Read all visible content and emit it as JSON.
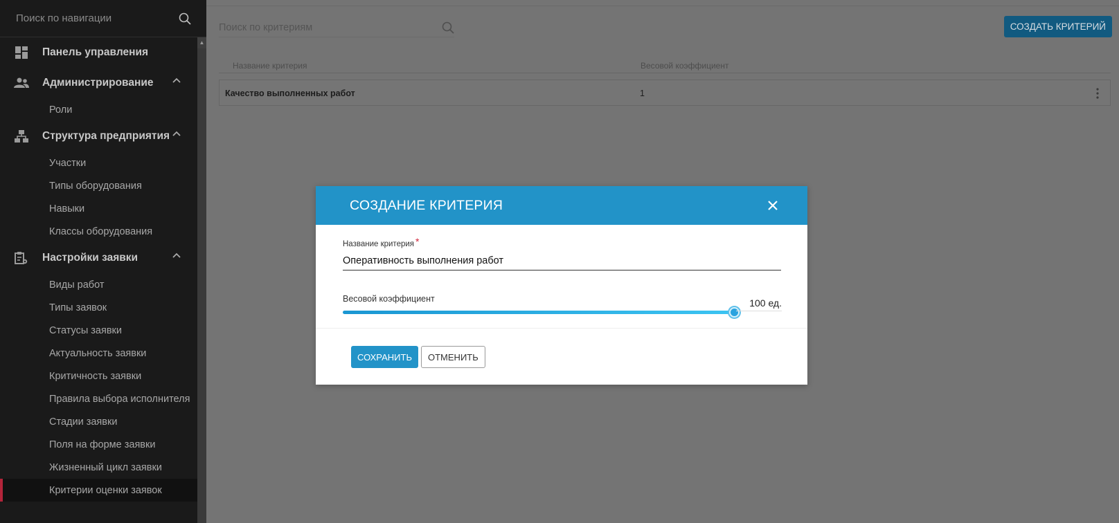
{
  "sidebar": {
    "search_placeholder": "Поиск по навигации",
    "sections": [
      {
        "label": "Панель управления",
        "icon": "dashboard-icon"
      },
      {
        "label": "Администрирование",
        "icon": "users-icon",
        "items": [
          "Роли"
        ]
      },
      {
        "label": "Структура предприятия",
        "icon": "org-structure-icon",
        "items": [
          "Участки",
          "Типы оборудования",
          "Навыки",
          "Классы оборудования"
        ]
      },
      {
        "label": "Настройки заявки",
        "icon": "clipboard-settings-icon",
        "items": [
          "Виды работ",
          "Типы заявок",
          "Статусы заявки",
          "Актуальность заявки",
          "Критичность заявки",
          "Правила выбора исполнителя",
          "Стадии заявки",
          "Поля на форме заявки",
          "Жизненный цикл заявки",
          "Критерии оценки заявок"
        ]
      }
    ],
    "active_item": "Критерии оценки заявок"
  },
  "main": {
    "search_placeholder": "Поиск по критериям",
    "create_button": "СОЗДАТЬ КРИТЕРИЙ",
    "table": {
      "columns": [
        "Название критерия",
        "Весовой коэффициент"
      ],
      "rows": [
        {
          "name": "Качество выполненных работ",
          "weight": "1"
        }
      ]
    }
  },
  "modal": {
    "title": "СОЗДАНИЕ КРИТЕРИЯ",
    "name_label": "Название критерия",
    "required_mark": "*",
    "name_value": "Оперативность выполнения работ",
    "weight_label": "Весовой коэффициент",
    "weight_display": "100 ед.",
    "weight_level": 1.0,
    "save_button": "СОХРАНИТЬ",
    "cancel_button": "ОТМЕНИТЬ"
  },
  "colors": {
    "accent": "#2293c8",
    "sidebar_bg": "#1a1a1a",
    "active_marker": "#b3243a",
    "required": "#d0243a"
  }
}
